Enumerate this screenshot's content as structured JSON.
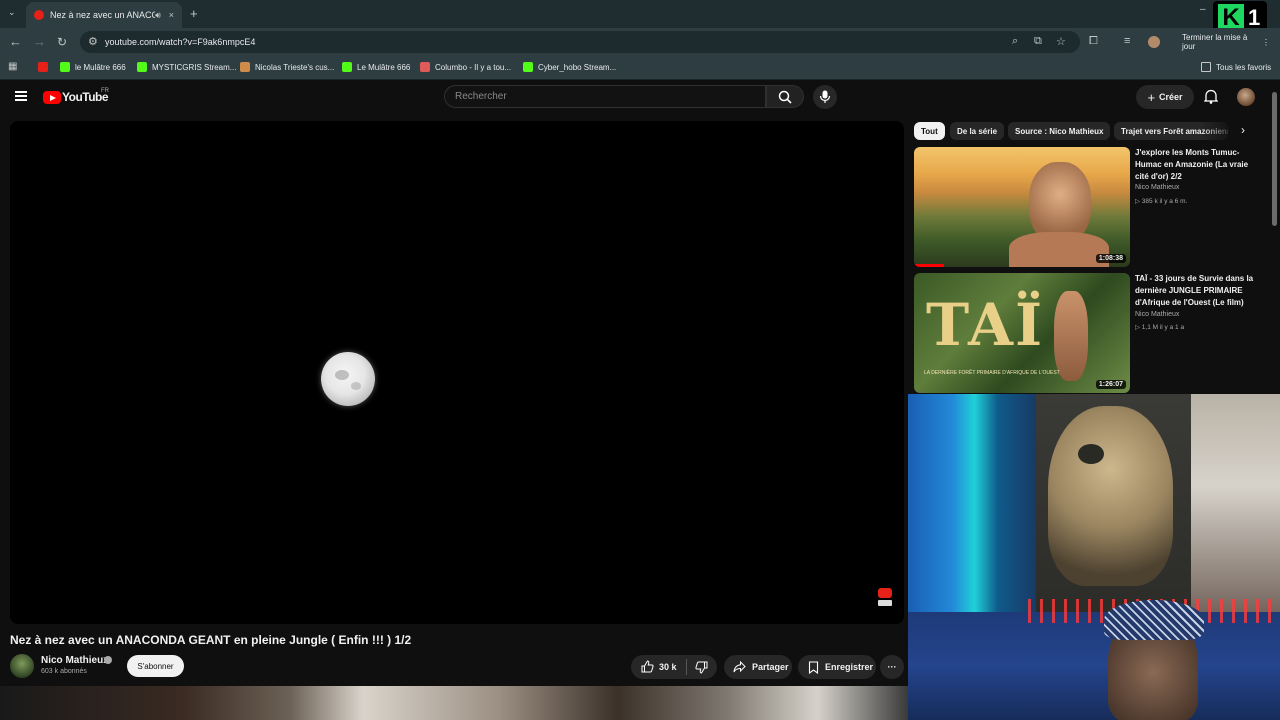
{
  "browser": {
    "tab": {
      "title": "Nez à nez avec un ANACONDA GEANT en pleine Jungle",
      "audio_icon": "speaker-icon",
      "close_icon": "×"
    },
    "new_tab": "+",
    "url": "youtube.com/watch?v=F9ak6nmpcE4",
    "update_button": "Terminer la mise à jour",
    "bookmarks": [
      {
        "label": "",
        "icon": "youtube-icon",
        "color": "#e62117"
      },
      {
        "label": "le Mulâtre 666",
        "icon": "play-icon",
        "color": "#53fc18"
      },
      {
        "label": "MYSTICGRIS Stream...",
        "icon": "kick-icon",
        "color": "#53fc18"
      },
      {
        "label": "Nicolas Trieste's cus...",
        "icon": "deer-icon",
        "color": "#d08b4a"
      },
      {
        "label": "Le Mulâtre 666",
        "icon": "play-icon",
        "color": "#53fc18"
      },
      {
        "label": "Columbo - Il y a tou...",
        "icon": "reddit-icon",
        "color": "#e05a5a"
      },
      {
        "label": "Cyber_hobo Stream...",
        "icon": "kick-icon",
        "color": "#53fc18"
      }
    ],
    "all_bookmarks": "Tous les favoris",
    "badge": {
      "letter": "K",
      "number": "1"
    }
  },
  "youtube": {
    "logo": "YouTube",
    "country": "FR",
    "search_placeholder": "Rechercher",
    "create_label": "Créer",
    "video": {
      "title": "Nez à nez avec un ANACONDA GEANT en pleine Jungle ( Enfin !!! ) 1/2",
      "channel": "Nico Mathieux",
      "subscribers": "603 k abonnés",
      "subscribe_label": "S'abonner",
      "likes": "30 k",
      "share_label": "Partager",
      "save_label": "Enregistrer",
      "more_label": "···"
    },
    "chips": [
      "Tout",
      "De la série",
      "Source : Nico Mathieux",
      "Trajet vers Forêt amazonienne"
    ],
    "recommendations": [
      {
        "title": "J'explore les Monts Tumuc-Humac en Amazonie (La vraie cité d'or) 2/2",
        "channel": "Nico Mathieux",
        "meta": "▷ 385 k  il y a 6 m.",
        "duration": "1:08:38"
      },
      {
        "title": "TAÏ - 33 jours de Survie dans la dernière JUNGLE PRIMAIRE d'Afrique de l'Ouest (Le film)",
        "channel": "Nico Mathieux",
        "meta": "▷ 1,1 M  il y a 1 a",
        "duration": "1:26:07",
        "thumb_text": "TAÏ",
        "thumb_subtext": "LA DERNIÈRE FORÊT PRIMAIRE D'AFRIQUE DE L'OUEST"
      }
    ]
  }
}
